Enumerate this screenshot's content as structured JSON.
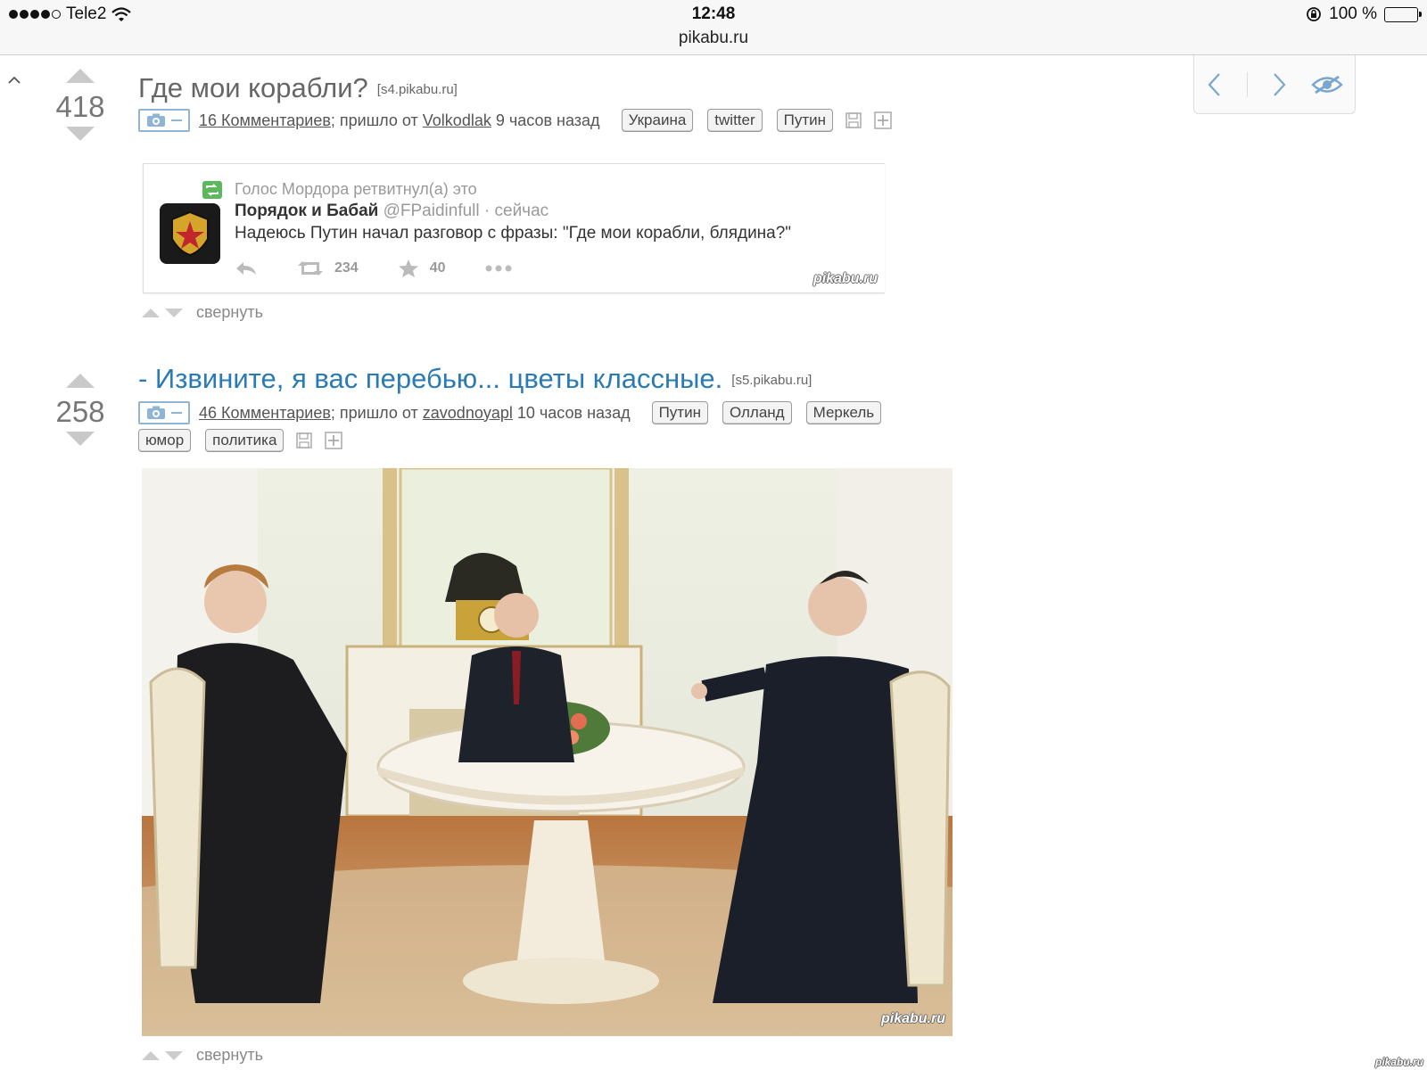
{
  "status_bar": {
    "carrier": "Tele2",
    "time": "12:48",
    "url": "pikabu.ru",
    "battery": "100 %"
  },
  "stories": [
    {
      "rating": "418",
      "title": "Где мои корабли?",
      "domain": "[s4.pikabu.ru]",
      "comments": "16 Комментариев",
      "from_text": "; пришло от",
      "author": "Volkodlak",
      "time": "9 часов назад",
      "tags": [
        "Украина",
        "twitter",
        "Путин"
      ],
      "fold": "свернуть",
      "title_color": "#666666"
    },
    {
      "rating": "258",
      "title": "- Извините, я вас перебью... цветы классные.",
      "domain": "[s5.pikabu.ru]",
      "comments": "46 Комментариев",
      "from_text": "; пришло от",
      "author": "zavodnoyapl",
      "time": "10 часов назад",
      "tags": [
        "Путин",
        "Олланд",
        "Меркель",
        "юмор",
        "политика"
      ],
      "fold": "свернуть",
      "title_color": "#2a7bb5"
    }
  ],
  "tweet": {
    "retweeted_by": "Голос Мордора ретвитнул(а) это",
    "name": "Порядок и Бабай",
    "handle": "@FPaidinfull",
    "when": "· сейчас",
    "text": "Надеюсь Путин начал разговор с фразы: \"Где мои корабли, блядина?\"",
    "retweets": "234",
    "favorites": "40",
    "watermark": "pikabu.ru"
  },
  "photo": {
    "watermark": "pikabu.ru"
  },
  "corner_watermark": "pikabu.ru",
  "colors": {
    "accent": "#2a7bb5",
    "nav_icons": "#7aa7cf",
    "vote_arrows": "#c9c9c9"
  },
  "icons": [
    "up-caret-icon",
    "prev-icon",
    "next-icon",
    "hide-eye-icon",
    "camera-icon",
    "save-icon",
    "add-icon",
    "retweet-icon",
    "reply-icon",
    "star-icon",
    "more-icon"
  ]
}
